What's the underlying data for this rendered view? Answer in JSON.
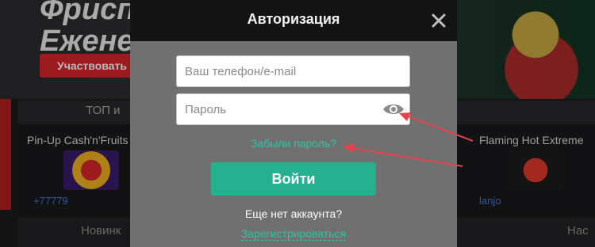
{
  "background": {
    "banner_title_line1": "Фриспины",
    "banner_title_line2": "Еженед",
    "banner_cta": "Участвовать",
    "tab_top": "ТОП и",
    "game_left_title": "Pin-Up Cash'n'Fruits",
    "game_left_meta": "+77779",
    "game_right_title": "Flaming Hot Extreme",
    "game_right_meta": "lanjo",
    "bottom_left": "Новинк",
    "bottom_right": "Нас"
  },
  "modal": {
    "title": "Авторизация",
    "login_placeholder": "Ваш телефон/e-mail",
    "password_placeholder": "Пароль",
    "forgot_password": "Забыли пароль?",
    "login_button": "Войти",
    "no_account": "Еще нет аккаунта?",
    "register": "Зарегистрироваться"
  },
  "icons": {
    "close": "close-icon",
    "show_password": "eye-icon"
  },
  "colors": {
    "accent": "#25b18f",
    "link": "#2ec4a4",
    "header": "#141414",
    "modal_body": "#707070",
    "annotation_arrow": "#e8434b"
  }
}
